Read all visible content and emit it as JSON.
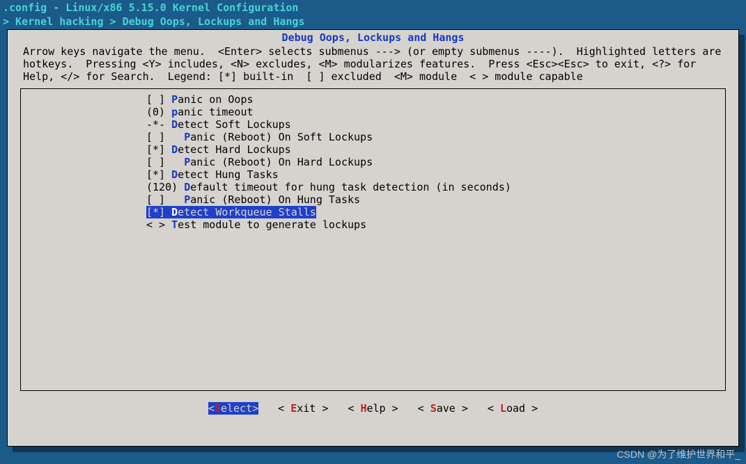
{
  "title": ".config - Linux/x86 5.15.0 Kernel Configuration",
  "breadcrumb": "> Kernel hacking > Debug Oops, Lockups and Hangs",
  "section_title": "Debug Oops, Lockups and Hangs",
  "help_text": "Arrow keys navigate the menu.  <Enter> selects submenus ---> (or empty submenus ----).  Highlighted letters are hotkeys.  Pressing <Y> includes, <N> excludes, <M> modularizes features.  Press <Esc><Esc> to exit, <?> for Help, </> for Search.  Legend: [*] built-in  [ ] excluded  <M> module  < > module capable",
  "menu": [
    {
      "prefix": "[ ] ",
      "hot": "P",
      "rest": "anic on Oops",
      "selected": false
    },
    {
      "prefix": "(0) ",
      "hot": "p",
      "rest": "anic timeout",
      "selected": false
    },
    {
      "prefix": "-*- ",
      "hot": "D",
      "rest": "etect Soft Lockups",
      "selected": false
    },
    {
      "prefix": "[ ]   ",
      "hot": "P",
      "rest": "anic (Reboot) On Soft Lockups",
      "selected": false
    },
    {
      "prefix": "[*] ",
      "hot": "D",
      "rest": "etect Hard Lockups",
      "selected": false
    },
    {
      "prefix": "[ ]   ",
      "hot": "P",
      "rest": "anic (Reboot) On Hard Lockups",
      "selected": false
    },
    {
      "prefix": "[*] ",
      "hot": "D",
      "rest": "etect Hung Tasks",
      "selected": false
    },
    {
      "prefix": "(120) ",
      "hot": "D",
      "rest": "efault timeout for hung task detection (in seconds)",
      "selected": false
    },
    {
      "prefix": "[ ]   ",
      "hot": "P",
      "rest": "anic (Reboot) On Hung Tasks",
      "selected": false
    },
    {
      "prefix": "[*] ",
      "hot": "D",
      "rest": "etect Workqueue Stalls",
      "selected": true
    },
    {
      "prefix": "< > ",
      "hot": "T",
      "rest": "est module to generate lockups",
      "selected": false
    }
  ],
  "buttons": [
    {
      "pre": "<",
      "hot": "S",
      "post": "elect>",
      "selected": true
    },
    {
      "pre": "< ",
      "hot": "E",
      "post": "xit >",
      "selected": false
    },
    {
      "pre": "< ",
      "hot": "H",
      "post": "elp >",
      "selected": false
    },
    {
      "pre": "< ",
      "hot": "S",
      "post": "ave >",
      "selected": false
    },
    {
      "pre": "< ",
      "hot": "L",
      "post": "oad >",
      "selected": false
    }
  ],
  "watermark": "CSDN @为了维护世界和平_"
}
